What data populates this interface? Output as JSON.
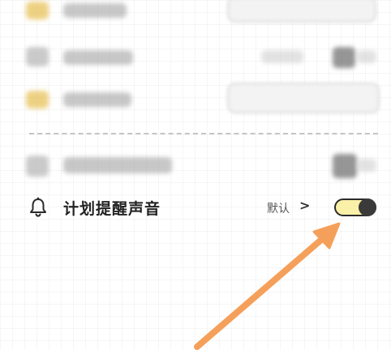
{
  "sound_setting": {
    "label": "计划提醒声音",
    "value": "默认",
    "chevron": ">",
    "toggle_on": true
  },
  "icons": {
    "row_icon": "bell-icon",
    "value_chevron": "chevron-right-icon"
  },
  "colors": {
    "toggle_track": "#fbf0a8",
    "toggle_knob": "#3a3a3a",
    "annotation_arrow": "#f5a05a"
  }
}
